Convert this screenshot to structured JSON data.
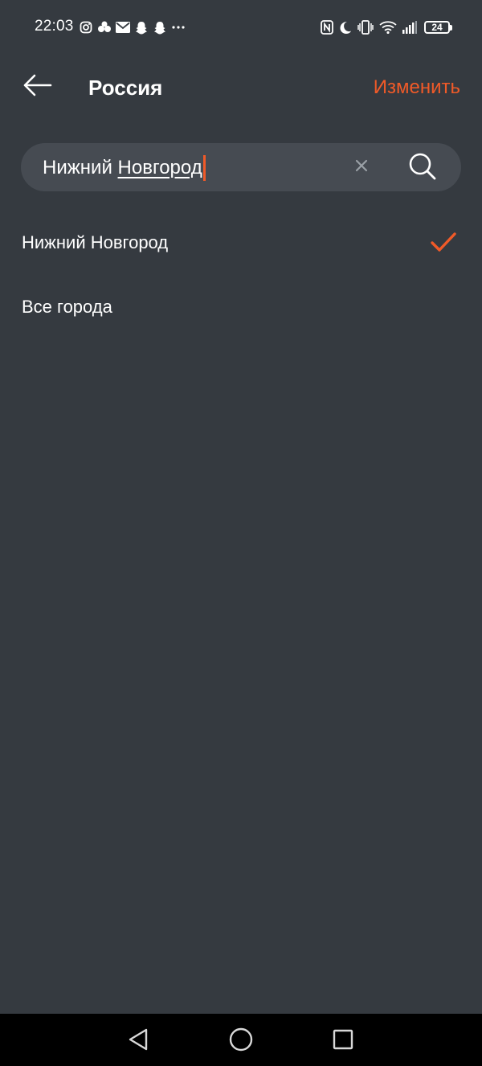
{
  "status_bar": {
    "time": "22:03",
    "left_icons": [
      "instagram-icon",
      "messenger-icon",
      "mail-icon",
      "snapchat-icon",
      "snapchat-icon",
      "more-dots-icon"
    ],
    "right_icons": [
      "nfc-icon",
      "do-not-disturb-moon-icon",
      "vibrate-icon",
      "wifi-icon",
      "signal-icon"
    ],
    "battery": "24"
  },
  "header": {
    "title": "Россия",
    "edit_label": "Изменить",
    "back_icon": "arrow-left-icon"
  },
  "search": {
    "value_prefix": "Нижний ",
    "value_composing": "Новгород",
    "clear_icon": "close-icon",
    "search_icon": "search-icon"
  },
  "list": {
    "items": [
      {
        "label": "Нижний Новгород",
        "selected": true
      },
      {
        "label": "Все города",
        "selected": false
      }
    ]
  },
  "nav_bar": {
    "buttons": [
      "back-triangle-icon",
      "home-circle-icon",
      "recents-square-icon"
    ]
  },
  "colors": {
    "background": "#353a40",
    "search_background": "#464b52",
    "accent": "#f05a28",
    "nav_background": "#000000"
  }
}
